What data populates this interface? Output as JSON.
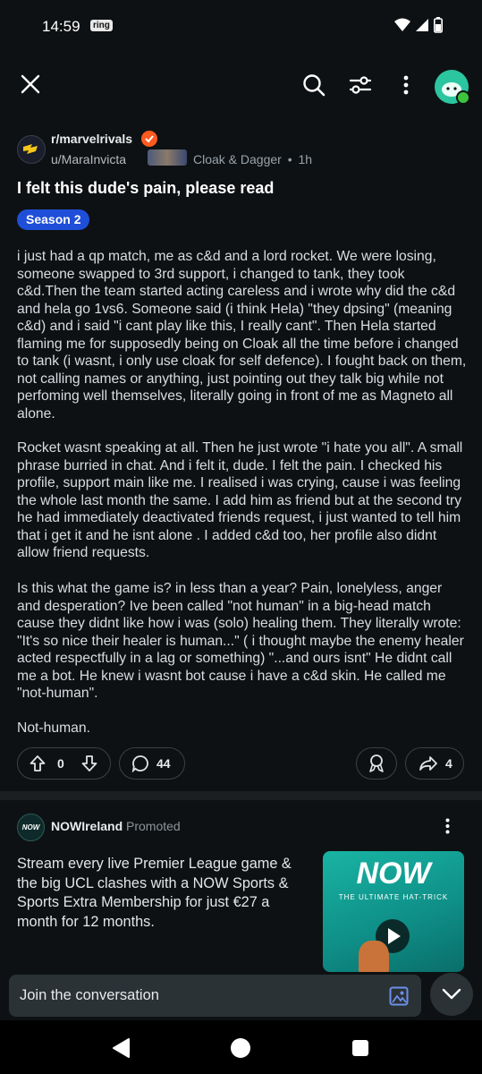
{
  "status": {
    "time": "14:59",
    "app_badge": "ring"
  },
  "topbar": {
    "close_icon": "close-icon",
    "search_icon": "search-icon",
    "filter_icon": "sliders-icon",
    "more_icon": "more-vertical-icon",
    "avatar_color": "#2bc5a0"
  },
  "post": {
    "subreddit": "r/marvelrivals",
    "author": "u/MaraInvicta",
    "author_flair": "Cloak & Dagger",
    "separator": "•",
    "age": "1h",
    "title": "I felt this dude's pain, please read",
    "flair": "Season 2",
    "paragraphs": [
      "i just had a qp match, me as c&d and a lord rocket. We were losing, someone swapped to 3rd support, i changed to tank, they took c&d.Then the team started acting careless and i wrote why did the c&d and hela go 1vs6. Someone said (i think Hela) \"they dpsing\" (meaning c&d) and i said \"i cant play like this, I really cant\". Then Hela started flaming me for supposedly being on Cloak all the time before i changed to tank (i wasnt, i only use cloak for self defence). I fought back on them, not calling names or anything, just pointing out they talk big while not perfoming well themselves, literally going in front of me as Magneto all alone.",
      "Rocket wasnt speaking at all. Then he just wrote \"i hate you all\". A small phrase burried in chat. And i felt it, dude. I felt the pain. I checked his profile, support main like me. I realised i was crying, cause i was feeling the whole last month the same. I add him as friend but at the second try he had immediately deactivated friends request, i just wanted to tell him that i get it and he isnt alone . I added c&d too, her profile also didnt allow friend requests.",
      "Is this what the game is? in less than a year? Pain, lonelyless, anger and desperation? Ive been called \"not human\" in a big-head match cause they didnt like how i was (solo) healing them. They literally wrote: \"It's so nice their healer is human...\" ( i thought maybe the enemy healer acted respectfully in a lag or something) \"...and ours isnt\" He didnt call me a bot. He knew i wasnt bot cause i have a c&d skin. He called me \"not-human\".",
      "Not-human."
    ],
    "votes": "0",
    "comments": "44",
    "shares": "4"
  },
  "ad": {
    "advertiser": "NOWIreland",
    "promoted_label": "Promoted",
    "text": "Stream every live Premier League game & the big UCL clashes with a NOW Sports & Sports Extra Membership for just €27 a month for 12 months.",
    "image_logo": "NOW",
    "image_tagline": "THE ULTIMATE HAT-TRICK",
    "brand_color": "#19b4a3"
  },
  "composer": {
    "placeholder": "Join the conversation"
  }
}
